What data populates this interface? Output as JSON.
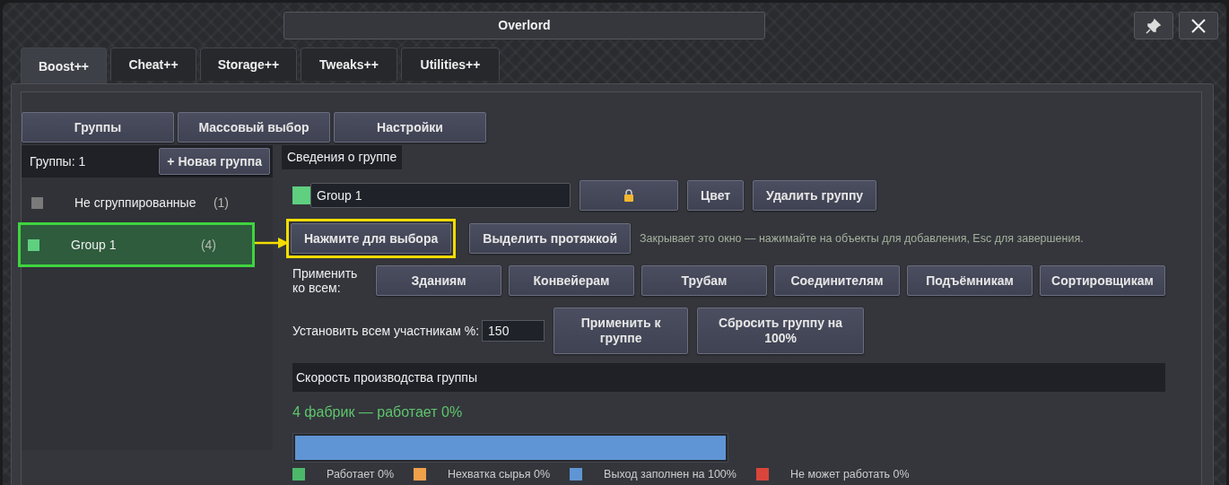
{
  "window": {
    "title": "Overlord"
  },
  "tabs": [
    {
      "label": "Boost++",
      "selected": true
    },
    {
      "label": "Cheat++",
      "selected": false
    },
    {
      "label": "Storage++",
      "selected": false
    },
    {
      "label": "Tweaks++",
      "selected": false
    },
    {
      "label": "Utilities++",
      "selected": false
    }
  ],
  "sections": [
    "Группы",
    "Массовый выбор",
    "Настройки"
  ],
  "groups_panel": {
    "count_label": "Группы: 1",
    "new_button": "+ Новая группа",
    "items": [
      {
        "name": "Не сгруппированные",
        "count": "(1)",
        "color": "#7a7a7a",
        "selected": false
      },
      {
        "name": "Group 1",
        "count": "(4)",
        "color": "#5fcf80",
        "selected": true
      }
    ]
  },
  "details": {
    "header": "Сведения о группе",
    "color": "#5fcf80",
    "name_value": "Group 1",
    "color_button": "Цвет",
    "delete_button": "Удалить группу",
    "select_button": {
      "label": "Нажмите для выбора",
      "highlighted": true
    },
    "drag_button": "Выделить протяжкой",
    "hint": "Закрывает это окно — нажимайте на объекты для добавления, Esc для завершения.",
    "apply_label": "Применить ко всем:",
    "apply_buttons": [
      "Зданиям",
      "Конвейерам",
      "Трубам",
      "Соединителям",
      "Подъёмникам",
      "Сортировщикам"
    ],
    "set_label": "Установить всем участникам %:",
    "percent_value": "150",
    "apply_group_button": "Применить к группе",
    "reset_button": "Сбросить группу на 100%"
  },
  "production": {
    "header": "Скорость производства группы",
    "summary": "4 фабрик — работает 0%",
    "bar": {
      "level": 1
    },
    "segments": [
      {
        "label": "Работает 0%",
        "color": "#4cb86a"
      },
      {
        "label": "Нехватка сырья 0%",
        "color": "#f0a04b"
      },
      {
        "label": "Выход заполнен на 100%",
        "color": "#5f95d4"
      },
      {
        "label": "Не может работать 0%",
        "color": "#d9453b"
      }
    ]
  }
}
